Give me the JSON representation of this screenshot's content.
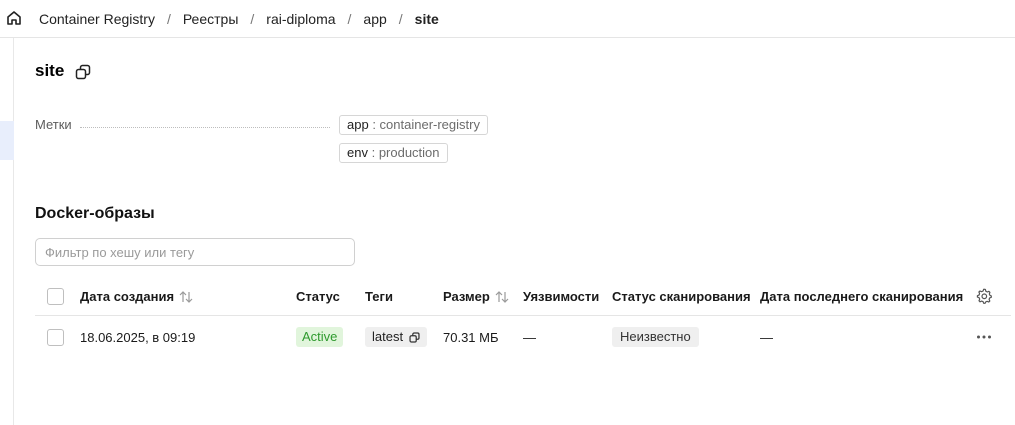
{
  "breadcrumbs": [
    "Container Registry",
    "Реестры",
    "rai-diploma",
    "app",
    "site"
  ],
  "breadcrumb_separator": "/",
  "page": {
    "title": "site"
  },
  "labels": {
    "key": "Метки",
    "chips": [
      {
        "k": "app",
        "sep": " : ",
        "v": "container-registry"
      },
      {
        "k": "env",
        "sep": " : ",
        "v": "production"
      }
    ]
  },
  "images": {
    "title": "Docker-образы",
    "filter_placeholder": "Фильтр по хешу или тегу",
    "filter_value": "",
    "columns": {
      "created": "Дата создания",
      "status": "Статус",
      "tags": "Теги",
      "size": "Размер",
      "vulns": "Уязвимости",
      "scan_status": "Статус сканирования",
      "last_scan": "Дата последнего сканирования"
    },
    "rows": [
      {
        "created": "18.06.2025, в 09:19",
        "status": "Active",
        "tag": "latest",
        "size": "70.31 МБ",
        "vulns": "—",
        "scan_status": "Неизвестно",
        "last_scan": "—"
      }
    ]
  },
  "colors": {
    "status_active_bg": "#e1f5dc",
    "status_active_fg": "#2e9a2e",
    "rail_active": "#e8eefc"
  },
  "icons": [
    "home-icon",
    "copy-icon",
    "sort-icon",
    "gear-icon",
    "more-icon"
  ]
}
